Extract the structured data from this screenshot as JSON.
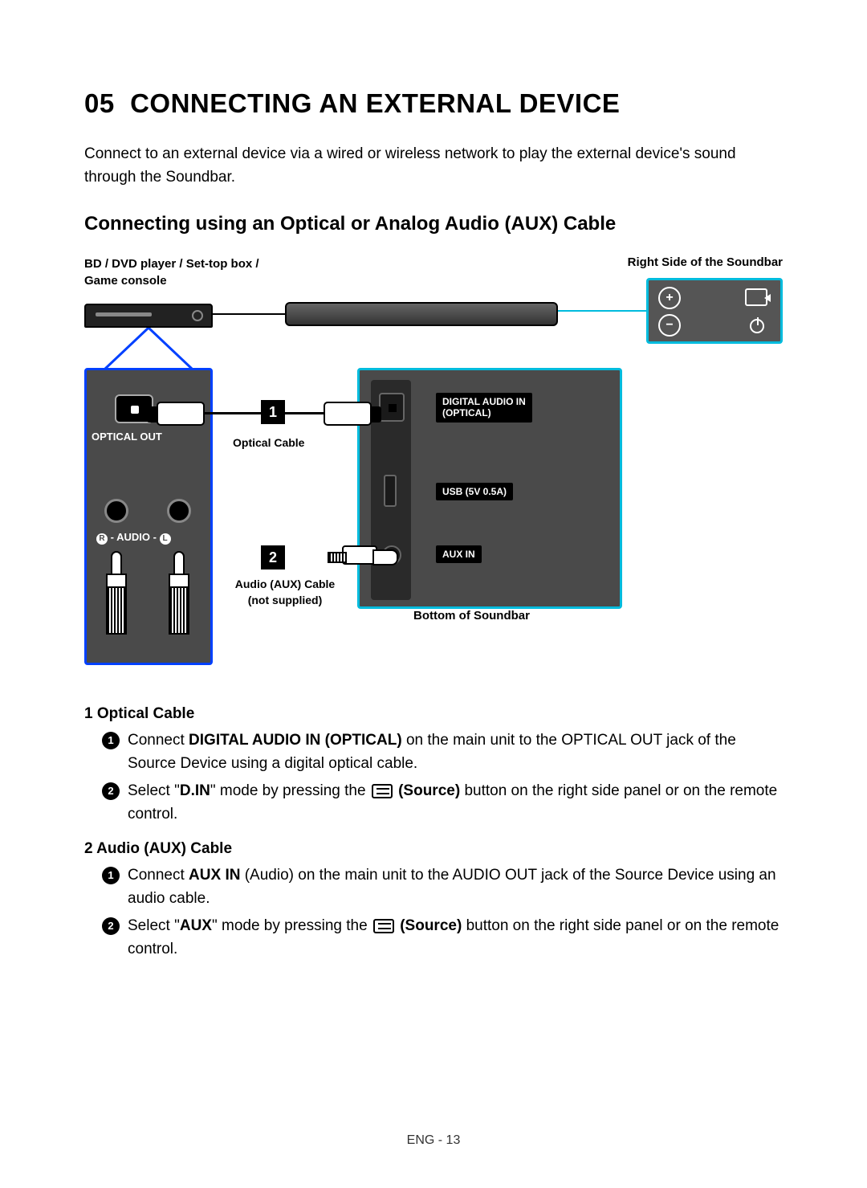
{
  "header": {
    "section_num": "05",
    "section_title": "CONNECTING AN EXTERNAL DEVICE"
  },
  "intro": "Connect to an external device via a wired or wireless network to play the external device's sound through the Soundbar.",
  "subheading": "Connecting using an Optical or Analog Audio (AUX) Cable",
  "diagram": {
    "source_device_label": "BD / DVD player / Set-top box /\nGame console",
    "right_side_label": "Right Side of the Soundbar",
    "optical_out_label": "OPTICAL OUT",
    "audio_rl_label_r": "R",
    "audio_rl_label_mid": " - AUDIO - ",
    "audio_rl_label_l": "L",
    "optical_cable_label": "Optical Cable",
    "aux_cable_label_1": "Audio (AUX) Cable",
    "aux_cable_label_2": "(not supplied)",
    "bottom_label": "Bottom of Soundbar",
    "panel_ports": {
      "digital_in": "DIGITAL AUDIO IN\n(OPTICAL)",
      "usb": "USB (5V 0.5A)",
      "aux": "AUX IN"
    },
    "num1": "1",
    "num2": "2",
    "right_panel_plus": "+",
    "right_panel_minus": "−"
  },
  "instructions": {
    "optical": {
      "heading": "1  Optical Cable",
      "step1_a": "Connect ",
      "step1_b": "DIGITAL AUDIO IN (OPTICAL)",
      "step1_c": " on the main unit to the OPTICAL OUT jack of the Source Device using a digital optical cable.",
      "step2_a": "Select \"",
      "step2_b": "D.IN",
      "step2_c": "\" mode by pressing the ",
      "step2_d": "(Source)",
      "step2_e": " button on the right side panel or on the remote control."
    },
    "aux": {
      "heading": "2  Audio (AUX) Cable",
      "step1_a": "Connect ",
      "step1_b": "AUX IN",
      "step1_c": " (Audio) on the main unit to the AUDIO OUT jack of the Source Device using an audio cable.",
      "step2_a": "Select \"",
      "step2_b": "AUX",
      "step2_c": "\" mode by pressing the ",
      "step2_d": "(Source)",
      "step2_e": " button on the right side panel or on the remote control."
    }
  },
  "footer": "ENG - 13"
}
